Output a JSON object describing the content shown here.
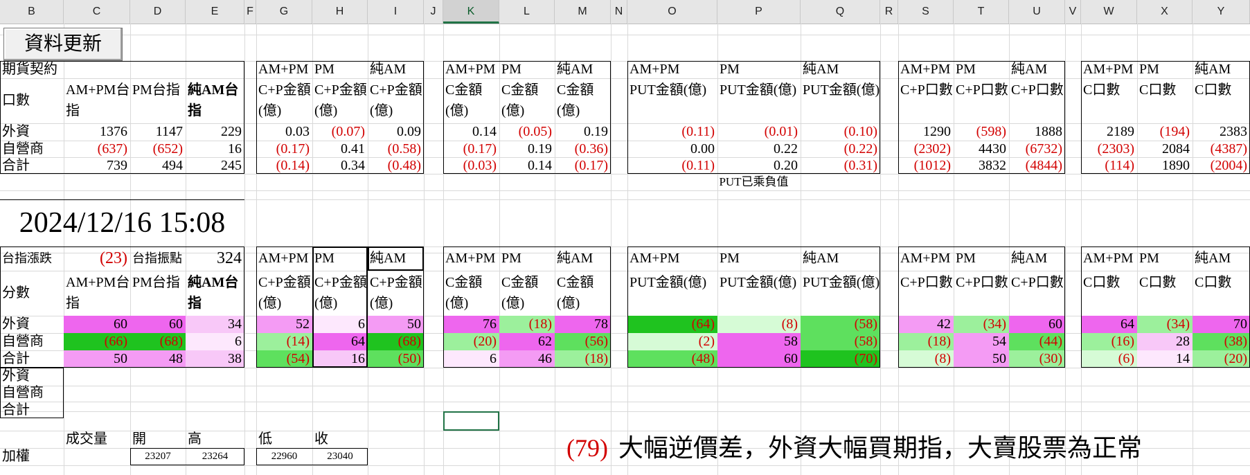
{
  "columns": [
    "B",
    "C",
    "D",
    "E",
    "F",
    "G",
    "H",
    "I",
    "J",
    "K",
    "L",
    "M",
    "N",
    "O",
    "P",
    "Q",
    "R",
    "S",
    "T",
    "U",
    "V",
    "W",
    "X",
    "Y"
  ],
  "refresh_button": "資料更新",
  "section1": {
    "title": "期貨契約",
    "row_label": "口數",
    "headers": [
      "AM+PM台指",
      "PM台指",
      "純AM台指"
    ],
    "rows": [
      {
        "label": "外資",
        "values": [
          "1376",
          "1147",
          "229"
        ]
      },
      {
        "label": "自營商",
        "values": [
          "(637)",
          "(652)",
          "16"
        ]
      },
      {
        "label": "合計",
        "values": [
          "739",
          "494",
          "245"
        ]
      }
    ]
  },
  "datetime": "2024/12/16 15:08",
  "index_change_label": "台指漲跌",
  "index_change_value": "(23)",
  "index_range_label": "台指振點",
  "index_range_value": "324",
  "section2": {
    "row_label": "分數",
    "headers": [
      "AM+PM台指",
      "PM台指",
      "純AM台指"
    ],
    "rows": [
      {
        "label": "外資",
        "values": [
          "60",
          "60",
          "34"
        ]
      },
      {
        "label": "自營商",
        "values": [
          "(66)",
          "(68)",
          "6"
        ]
      },
      {
        "label": "合計",
        "values": [
          "50",
          "48",
          "38"
        ]
      }
    ],
    "extra_rows": [
      "外資",
      "自營商",
      "合計"
    ]
  },
  "period_headers": [
    "AM+PM",
    "PM",
    "純AM"
  ],
  "options_top": [
    {
      "subheaders": [
        "C+P金額(億)",
        "C+P金額(億)",
        "C+P金額(億)"
      ],
      "rows": [
        [
          "0.03",
          "(0.07)",
          "0.09"
        ],
        [
          "(0.17)",
          "0.41",
          "(0.58)"
        ],
        [
          "(0.14)",
          "0.34",
          "(0.48)"
        ]
      ]
    },
    {
      "subheaders": [
        "C金額(億)",
        "C金額(億)",
        "C金額(億)"
      ],
      "rows": [
        [
          "0.14",
          "(0.05)",
          "0.19"
        ],
        [
          "(0.17)",
          "0.19",
          "(0.36)"
        ],
        [
          "(0.03)",
          "0.14",
          "(0.17)"
        ]
      ]
    },
    {
      "subheaders": [
        "PUT金額(億)",
        "PUT金額(億)",
        "PUT金額(億)"
      ],
      "rows": [
        [
          "(0.11)",
          "(0.01)",
          "(0.10)"
        ],
        [
          "0.00",
          "0.22",
          "(0.22)"
        ],
        [
          "(0.11)",
          "0.20",
          "(0.31)"
        ]
      ]
    },
    {
      "subheaders": [
        "C+P口數",
        "C+P口數",
        "C+P口數"
      ],
      "rows": [
        [
          "1290",
          "(598)",
          "1888"
        ],
        [
          "(2302)",
          "4430",
          "(6732)"
        ],
        [
          "(1012)",
          "3832",
          "(4844)"
        ]
      ]
    },
    {
      "subheaders": [
        "C口數",
        "C口數",
        "C口數"
      ],
      "rows": [
        [
          "2189",
          "(194)",
          "2383"
        ],
        [
          "(2303)",
          "2084",
          "(4387)"
        ],
        [
          "(114)",
          "1890",
          "(2004)"
        ]
      ]
    }
  ],
  "put_note": "PUT已乘負值",
  "options_bottom": [
    {
      "subheaders": [
        "C+P金額(億)",
        "C+P金額(億)",
        "C+P金額(億)"
      ],
      "rows": [
        [
          "52",
          "6",
          "50"
        ],
        [
          "(14)",
          "64",
          "(68)"
        ],
        [
          "(54)",
          "16",
          "(50)"
        ]
      ]
    },
    {
      "subheaders": [
        "C金額(億)",
        "C金額(億)",
        "C金額(億)"
      ],
      "rows": [
        [
          "76",
          "(18)",
          "78"
        ],
        [
          "(20)",
          "62",
          "(56)"
        ],
        [
          "6",
          "46",
          "(18)"
        ]
      ]
    },
    {
      "subheaders": [
        "PUT金額(億)",
        "PUT金額(億)",
        "PUT金額(億)"
      ],
      "rows": [
        [
          "(64)",
          "(8)",
          "(58)"
        ],
        [
          "(2)",
          "58",
          "(58)"
        ],
        [
          "(48)",
          "60",
          "(70)"
        ]
      ]
    },
    {
      "subheaders": [
        "C+P口數",
        "C+P口數",
        "C+P口數"
      ],
      "rows": [
        [
          "42",
          "(34)",
          "60"
        ],
        [
          "(18)",
          "54",
          "(44)"
        ],
        [
          "(8)",
          "50",
          "(30)"
        ]
      ]
    },
    {
      "subheaders": [
        "C口數",
        "C口數",
        "C口數"
      ],
      "rows": [
        [
          "64",
          "(34)",
          "70"
        ],
        [
          "(16)",
          "28",
          "(38)"
        ],
        [
          "(6)",
          "14",
          "(20)"
        ]
      ]
    }
  ],
  "market": {
    "headers": [
      "成交量",
      "開",
      "高",
      "低",
      "收"
    ],
    "row_label": "加權",
    "values": [
      "23207",
      "23264",
      "22960",
      "23040"
    ]
  },
  "basis_value": "(79)",
  "comment": "大幅逆價差，外資大幅買期指，大賣股票為正常",
  "colors": {
    "pink_strong": "#ee66ee",
    "pink_mid": "#f49bf4",
    "pink_light": "#f8c8f8",
    "pink_pale": "#fde8fd",
    "green_strong": "#1fc31f",
    "green_mid": "#5ee05e",
    "green_light": "#9cf09c",
    "green_pale": "#d6fbd6",
    "negative_text": "#d20000",
    "selection": "#217346"
  }
}
